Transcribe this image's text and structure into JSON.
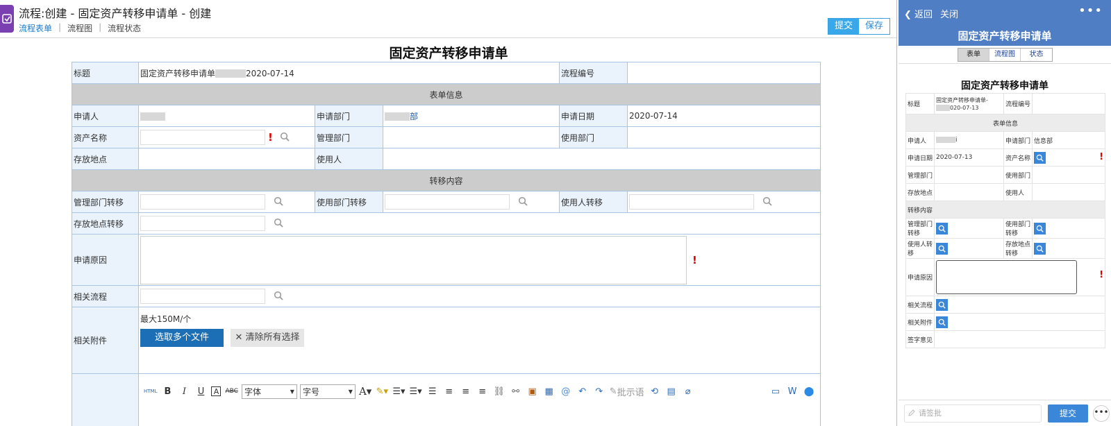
{
  "desktop": {
    "window_title": "流程:创建 - 固定资产转移申请单 - 创建",
    "tabs": [
      "流程表单",
      "流程图",
      "流程状态"
    ],
    "submit_label": "提交",
    "save_label": "保存",
    "form_title": "固定资产转移申请单",
    "fields": {
      "title_label": "标题",
      "title_value_prefix": "固定资产转移申请单",
      "title_value_date": "2020-07-14",
      "flow_no_label": "流程编号",
      "section_form_info": "表单信息",
      "applicant_label": "申请人",
      "apply_dept_label": "申请部门",
      "apply_dept_suffix": "部",
      "apply_date_label": "申请日期",
      "apply_date_value": "2020-07-14",
      "asset_name_label": "资产名称",
      "manage_dept_label": "管理部门",
      "use_dept_label": "使用部门",
      "location_label": "存放地点",
      "user_label": "使用人",
      "section_transfer": "转移内容",
      "manage_dept_transfer_label": "管理部门转移",
      "use_dept_transfer_label": "使用部门转移",
      "user_transfer_label": "使用人转移",
      "location_transfer_label": "存放地点转移",
      "reason_label": "申请原因",
      "related_flow_label": "相关流程",
      "attachment_label": "相关附件",
      "attachment_limit": "最大150M/个",
      "select_files_label": "选取多个文件",
      "clear_selection_label": "清除所有选择"
    },
    "editor": {
      "html_label": "HTML",
      "font_label": "字体",
      "size_label": "字号",
      "comment_label": "批示语"
    }
  },
  "mobile": {
    "back_label": "返回",
    "close_label": "关闭",
    "header_title": "固定资产转移申请单",
    "tabs": [
      "表单",
      "流程图",
      "状态"
    ],
    "form_title": "固定资产转移申请单",
    "title_label": "标题",
    "title_value_line1": "固定资产转移申请单-",
    "title_value_line2": "020-07-13",
    "flow_no_label": "流程编号",
    "section_form_info": "表单信息",
    "applicant_label": "申请人",
    "applicant_suffix": "i",
    "apply_dept_label": "申请部门",
    "apply_dept_value": "信息部",
    "apply_date_label": "申请日期",
    "apply_date_value": "2020-07-13",
    "asset_name_label": "资产名称",
    "manage_dept_label": "管理部门",
    "use_dept_label": "使用部门",
    "location_label": "存放地点",
    "user_label": "使用人",
    "section_transfer": "转移内容",
    "manage_dept_transfer_label": "管理部门转移",
    "use_dept_transfer_label": "使用部门转移",
    "user_transfer_label": "使用人转移",
    "location_transfer_label": "存放地点转移",
    "reason_label": "申请原因",
    "related_flow_label": "相关流程",
    "attachment_label": "相关附件",
    "sign_opinion_label": "签字意见",
    "comment_placeholder": "请签批",
    "submit_label": "提交"
  },
  "colors": {
    "primary_blue": "#1d6fb5",
    "header_blue": "#4f7ec4",
    "label_bg": "#eaf3fc",
    "section_bg": "#cccccc",
    "required_red": "#e00000",
    "logo_purple": "#7a3fb0"
  }
}
